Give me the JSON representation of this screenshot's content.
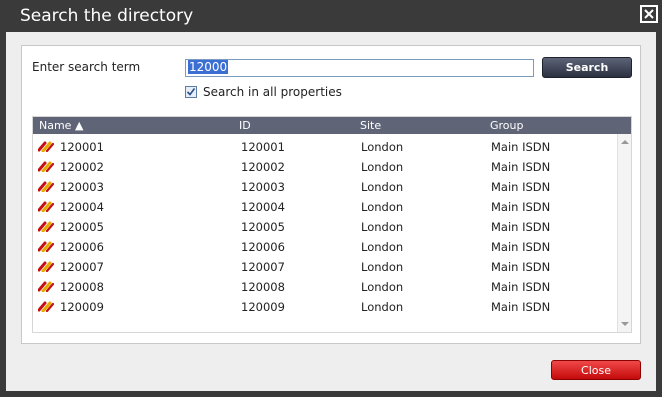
{
  "dialog": {
    "title": "Search the directory"
  },
  "search": {
    "label": "Enter search term",
    "value": "12000",
    "button_label": "Search",
    "all_properties_label": "Search in all properties",
    "all_properties_checked": true
  },
  "table": {
    "columns": [
      "Name ▲",
      "ID",
      "Site",
      "Group"
    ],
    "rows": [
      {
        "name": "120001",
        "id": "120001",
        "site": "London",
        "group": "Main ISDN"
      },
      {
        "name": "120002",
        "id": "120002",
        "site": "London",
        "group": "Main ISDN"
      },
      {
        "name": "120003",
        "id": "120003",
        "site": "London",
        "group": "Main ISDN"
      },
      {
        "name": "120004",
        "id": "120004",
        "site": "London",
        "group": "Main ISDN"
      },
      {
        "name": "120005",
        "id": "120005",
        "site": "London",
        "group": "Main ISDN"
      },
      {
        "name": "120006",
        "id": "120006",
        "site": "London",
        "group": "Main ISDN"
      },
      {
        "name": "120007",
        "id": "120007",
        "site": "London",
        "group": "Main ISDN"
      },
      {
        "name": "120008",
        "id": "120008",
        "site": "London",
        "group": "Main ISDN"
      },
      {
        "name": "120009",
        "id": "120009",
        "site": "London",
        "group": "Main ISDN"
      }
    ],
    "row_icon": "isdn-link-icon"
  },
  "footer": {
    "close_label": "Close"
  },
  "colors": {
    "title_bar": "#3a3a3a",
    "header_bg": "#5f6577",
    "search_button": "#2b3140",
    "close_button": "#d81e1e"
  }
}
